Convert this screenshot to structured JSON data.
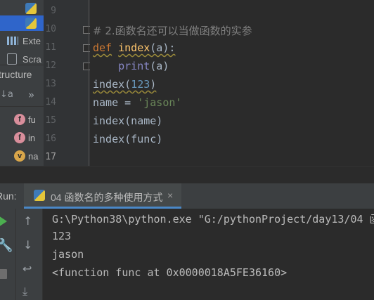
{
  "project_tree": {
    "items": [
      {
        "label": ""
      },
      {
        "label": ""
      },
      {
        "label": "Exte"
      },
      {
        "label": "Scra"
      }
    ]
  },
  "structure": {
    "title": "tructure",
    "toolbar": {
      "sort_icon": "↓a",
      "more_icon": "»"
    },
    "items": [
      {
        "kind": "f",
        "label": "fu"
      },
      {
        "kind": "f",
        "label": "in"
      },
      {
        "kind": "v",
        "label": "na"
      }
    ]
  },
  "editor": {
    "line_numbers": [
      "9",
      "10",
      "11",
      "12",
      "13",
      "14",
      "15",
      "16",
      "17"
    ],
    "lines": {
      "comment": "# 2.函数名还可以当做函数的实参",
      "def_kw": "def",
      "def_name": "index",
      "def_rest": "(a):",
      "print_kw": "print",
      "print_rest": "(a)",
      "call1_name": "index",
      "call1_open": "(",
      "call1_num": "123",
      "call1_close": ")",
      "assign_left": "name = ",
      "assign_str": "'jason'",
      "call2": "index(name)",
      "call3": "index(func)"
    }
  },
  "run": {
    "label": "Run:",
    "tab_label": "04 函数名的多种使用方式",
    "tab_close": "×"
  },
  "console": {
    "lines": [
      "G:\\Python38\\python.exe \"G:/pythonProject/day13/04 函",
      "123",
      "jason",
      "<function func at 0x0000018A5FE36160>"
    ]
  },
  "colors": {
    "keyword": "#cc7832",
    "function_name": "#ffc66d",
    "number": "#6897bb",
    "string": "#6a8759",
    "builtin": "#8888c6",
    "comment": "#808080",
    "run_green": "#4caf50",
    "selection": "#2f65ca"
  }
}
